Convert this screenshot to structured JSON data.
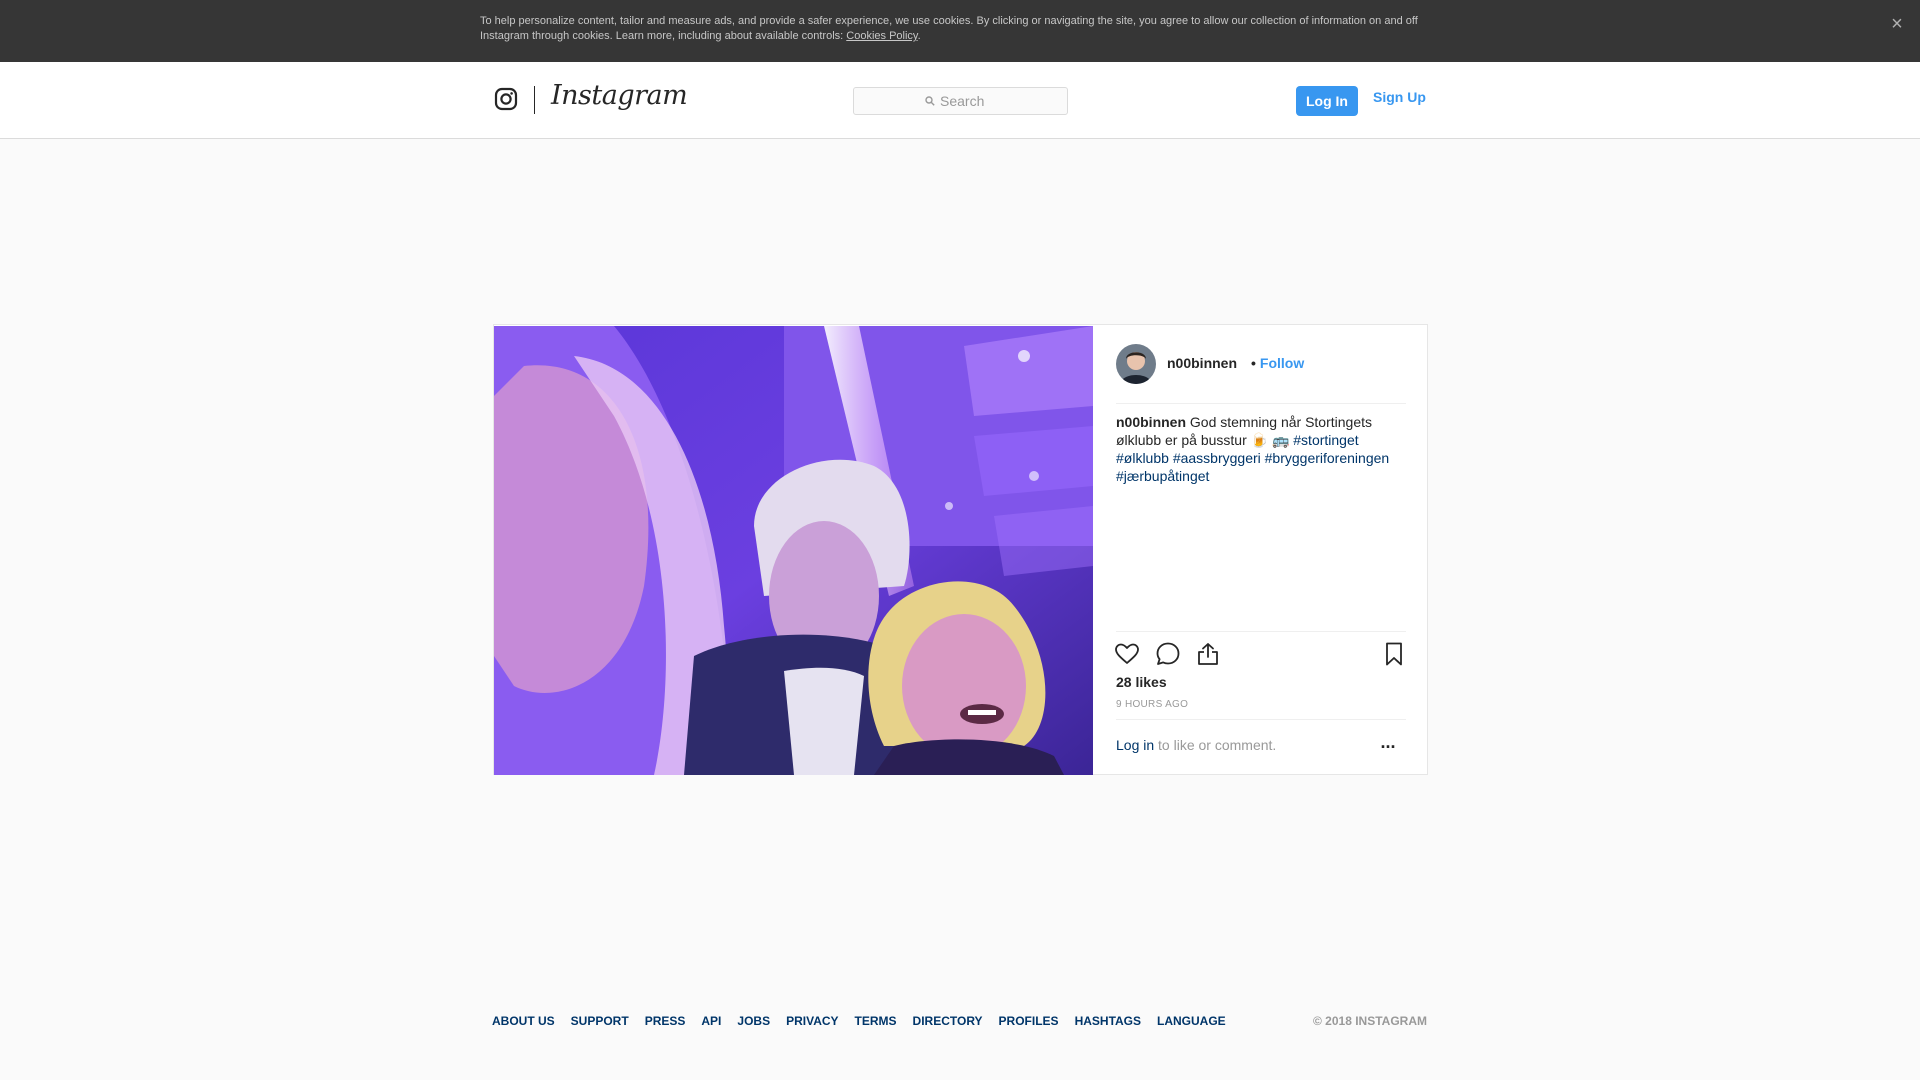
{
  "cookie_banner": {
    "text": "To help personalize content, tailor and measure ads, and provide a safer experience, we use cookies. By clicking or navigating the site, you agree to allow our collection of information on and off Instagram through cookies. Learn more, including about available controls: ",
    "link": "Cookies Policy",
    "end": ".",
    "close_icon": "close-icon"
  },
  "header": {
    "logo_icon": "instagram-glyph-icon",
    "wordmark": "Instagram",
    "search_placeholder": "Search",
    "login_label": "Log In",
    "signup_label": "Sign Up"
  },
  "post": {
    "username": "n00binnen",
    "follow_label": "Follow",
    "separator": "•",
    "caption_text": "God stemning når Stortingets ølklubb er på busstur 🍺 🚌",
    "hashtags": [
      "#stortinget",
      "#ølklubb",
      "#aassbryggeri",
      "#bryggeriforeningen",
      "#jærbupåtinget"
    ],
    "likes": "28 likes",
    "time": "9 HOURS AGO",
    "login_link": "Log in",
    "login_suffix": " to like or comment.",
    "more_label": "..."
  },
  "actions": [
    "heart-icon",
    "comment-icon",
    "share-icon",
    "bookmark-icon"
  ],
  "footer": {
    "links": [
      "ABOUT US",
      "SUPPORT",
      "PRESS",
      "API",
      "JOBS",
      "PRIVACY",
      "TERMS",
      "DIRECTORY",
      "PROFILES",
      "HASHTAGS",
      "LANGUAGE"
    ],
    "copyright": "© 2018 INSTAGRAM"
  },
  "colors": {
    "accent": "#3897f0",
    "link": "#003569",
    "banner_bg": "#363636"
  }
}
